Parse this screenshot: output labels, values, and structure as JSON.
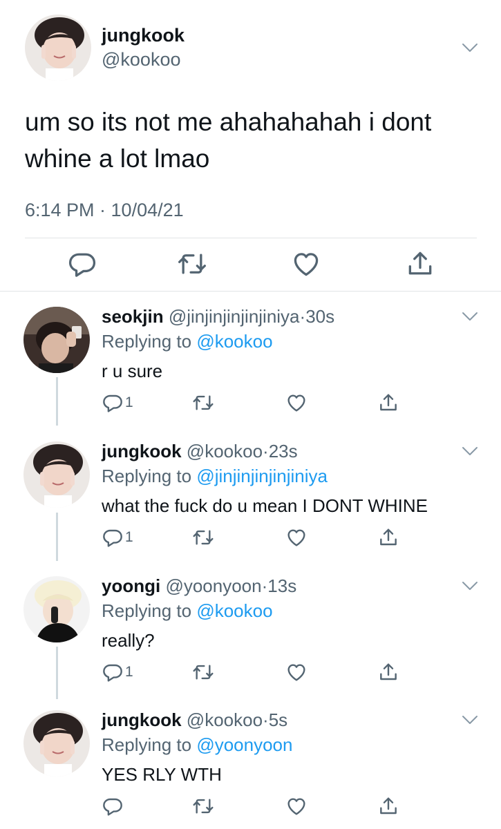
{
  "main_tweet": {
    "name": "jungkook",
    "handle": "@kookoo",
    "text": "um so its not me ahahahahah i dont whine a lot lmao",
    "timestamp": "6:14 PM · 10/04/21",
    "icons": [
      "reply-icon",
      "retweet-icon",
      "like-icon",
      "share-icon"
    ]
  },
  "replies": [
    {
      "name": "seokjin",
      "handle": "@jinjinjinjinjiniya",
      "dot": "·",
      "time": "30s",
      "replying_prefix": "Replying to ",
      "replying_to": "@kookoo",
      "text": "r u sure",
      "reply_count": "1"
    },
    {
      "name": "jungkook",
      "handle": "@kookoo",
      "dot": "·",
      "time": "23s",
      "replying_prefix": "Replying to ",
      "replying_to": "@jinjinjinjinjiniya",
      "text": "what the fuck do u mean I DONT WHINE",
      "reply_count": "1"
    },
    {
      "name": "yoongi",
      "handle": "@yoonyoon",
      "dot": "·",
      "time": "13s",
      "replying_prefix": "Replying to ",
      "replying_to": "@kookoo",
      "text": "really?",
      "reply_count": "1"
    },
    {
      "name": "jungkook",
      "handle": "@kookoo",
      "dot": "·",
      "time": "5s",
      "replying_prefix": "Replying to ",
      "replying_to": "@yoonyoon",
      "text": "YES RLY WTH",
      "reply_count": ""
    }
  ],
  "colors": {
    "text": "#0f1419",
    "secondary": "#536471",
    "link": "#1d9bf0",
    "divider": "#e1e4e6",
    "thread_line": "#cfd9de"
  }
}
